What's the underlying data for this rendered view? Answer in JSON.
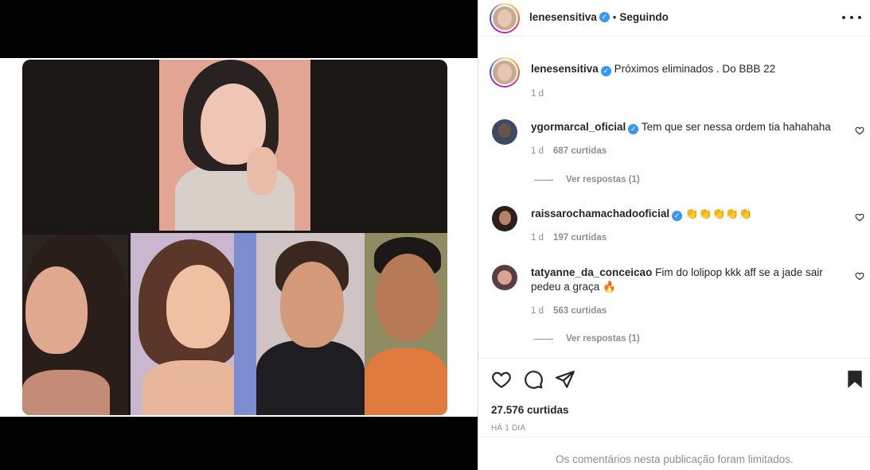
{
  "post": {
    "author": "lenesensitiva",
    "following_label": "Seguindo",
    "caption": "Próximos eliminados . Do BBB 22",
    "caption_time": "1 d"
  },
  "comments": [
    {
      "user": "ygormarcal_oficial",
      "verified": true,
      "text": "Tem que ser nessa ordem tia hahahaha",
      "time": "1 d",
      "likes": "687 curtidas",
      "replies": "Ver respostas (1)"
    },
    {
      "user": "raissarochamachadooficial",
      "verified": true,
      "text": "👏👏👏👏👏",
      "time": "1 d",
      "likes": "197 curtidas",
      "replies": ""
    },
    {
      "user": "tatyanne_da_conceicao",
      "verified": false,
      "text": "Fim do lolipop kkk aff se a jade sair pedeu a graça 🔥",
      "time": "1 d",
      "likes": "563 curtidas",
      "replies": "Ver respostas (1)"
    }
  ],
  "actions": {
    "like_icon": "heart-icon",
    "comment_icon": "comment-icon",
    "share_icon": "send-icon",
    "save_icon": "bookmark-icon"
  },
  "stats": {
    "likes_total": "27.576 curtidas",
    "time_ago": "HÁ 1 DIA"
  },
  "footer": {
    "limited_comments": "Os comentários nesta publicação foram limitados."
  },
  "colors": {
    "verified": "#3897f0",
    "muted_text": "#8e8e8e",
    "primary_text": "#262626"
  }
}
